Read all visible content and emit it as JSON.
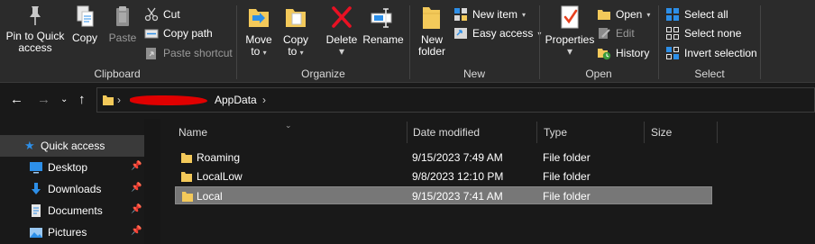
{
  "ribbon": {
    "clipboard": {
      "label": "Clipboard",
      "pin": "Pin to Quick\naccess",
      "pin_line1": "Pin to Quick",
      "pin_line2": "access",
      "copy": "Copy",
      "paste": "Paste",
      "cut": "Cut",
      "copy_path": "Copy path",
      "paste_shortcut": "Paste shortcut"
    },
    "organize": {
      "label": "Organize",
      "move_to_line1": "Move",
      "move_to_line2": "to",
      "copy_to_line1": "Copy",
      "copy_to_line2": "to",
      "delete": "Delete",
      "rename": "Rename"
    },
    "new": {
      "label": "New",
      "new_folder_line1": "New",
      "new_folder_line2": "folder",
      "new_item": "New item",
      "easy_access": "Easy access"
    },
    "open": {
      "label": "Open",
      "properties": "Properties",
      "open": "Open",
      "edit": "Edit",
      "history": "History"
    },
    "select": {
      "label": "Select",
      "select_all": "Select all",
      "select_none": "Select none",
      "invert_selection": "Invert selection"
    }
  },
  "address": {
    "current": "AppData"
  },
  "navpane": {
    "quick_access": "Quick access",
    "items": [
      {
        "label": "Desktop",
        "icon": "desktop-icon"
      },
      {
        "label": "Downloads",
        "icon": "downloads-icon"
      },
      {
        "label": "Documents",
        "icon": "documents-icon"
      },
      {
        "label": "Pictures",
        "icon": "pictures-icon"
      }
    ]
  },
  "columns": {
    "name": "Name",
    "date": "Date modified",
    "type": "Type",
    "size": "Size"
  },
  "files": [
    {
      "name": "Roaming",
      "date": "9/15/2023 7:49 AM",
      "type": "File folder",
      "size": ""
    },
    {
      "name": "LocalLow",
      "date": "9/8/2023 12:10 PM",
      "type": "File folder",
      "size": ""
    },
    {
      "name": "Local",
      "date": "9/15/2023 7:41 AM",
      "type": "File folder",
      "size": ""
    }
  ],
  "colors": {
    "accent": "#2d8fe8",
    "folder": "#f3c95a",
    "delete": "#e81123",
    "selection": "#777777"
  }
}
